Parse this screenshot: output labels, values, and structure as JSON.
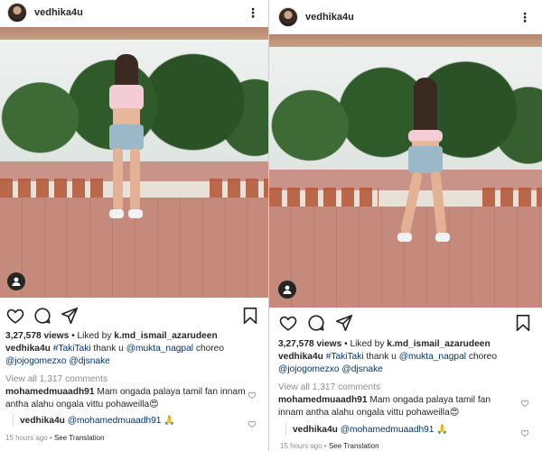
{
  "posts": [
    {
      "username": "vedhika4u",
      "views": "3,27,578 views",
      "liked_by_prefix": "Liked by",
      "liked_by_user": "k.md_ismail_azarudeen",
      "caption_user": "vedhika4u",
      "caption_hashtag": "#TakiTaki",
      "caption_text": " thank u ",
      "caption_mention1": "@mukta_nagpal",
      "caption_text2": " choreo",
      "caption_mention2": "@jojogomezxo",
      "caption_mention3": "@djsnake",
      "view_all_comments": "View all 1,317 comments",
      "comment_user": "mohamedmuaadh91",
      "comment_text": " Mam ongada palaya tamil fan innam antha alahu ongala vittu pohaweilla😍",
      "reply_user": "vedhika4u",
      "reply_mention": "@mohamedmuaadh91",
      "reply_text": " 🙏",
      "time": "15 hours ago",
      "see_translation": "See Translation"
    },
    {
      "username": "vedhika4u",
      "views": "3,27,578 views",
      "liked_by_prefix": "Liked by",
      "liked_by_user": "k.md_ismail_azarudeen",
      "caption_user": "vedhika4u",
      "caption_hashtag": "#TakiTaki",
      "caption_text": " thank u ",
      "caption_mention1": "@mukta_nagpal",
      "caption_text2": " choreo",
      "caption_mention2": "@jojogomezxo",
      "caption_mention3": "@djsnake",
      "view_all_comments": "View all 1,317 comments",
      "comment_user": "mohamedmuaadh91",
      "comment_text": " Mam ongada palaya tamil fan innam antha alahu ongala vittu pohaweilla😍",
      "reply_user": "vedhika4u",
      "reply_mention": "@mohamedmuaadh91",
      "reply_text": " 🙏",
      "time": "15 hours ago",
      "see_translation": "See Translation"
    }
  ],
  "separator": " • ",
  "colors": {
    "link": "#003569",
    "muted": "#8e8e8e",
    "text": "#262626"
  },
  "icons": [
    "avatar",
    "more-options-icon",
    "heart-icon",
    "comment-icon",
    "share-icon",
    "bookmark-icon",
    "user-tag-icon",
    "small-heart-icon"
  ]
}
